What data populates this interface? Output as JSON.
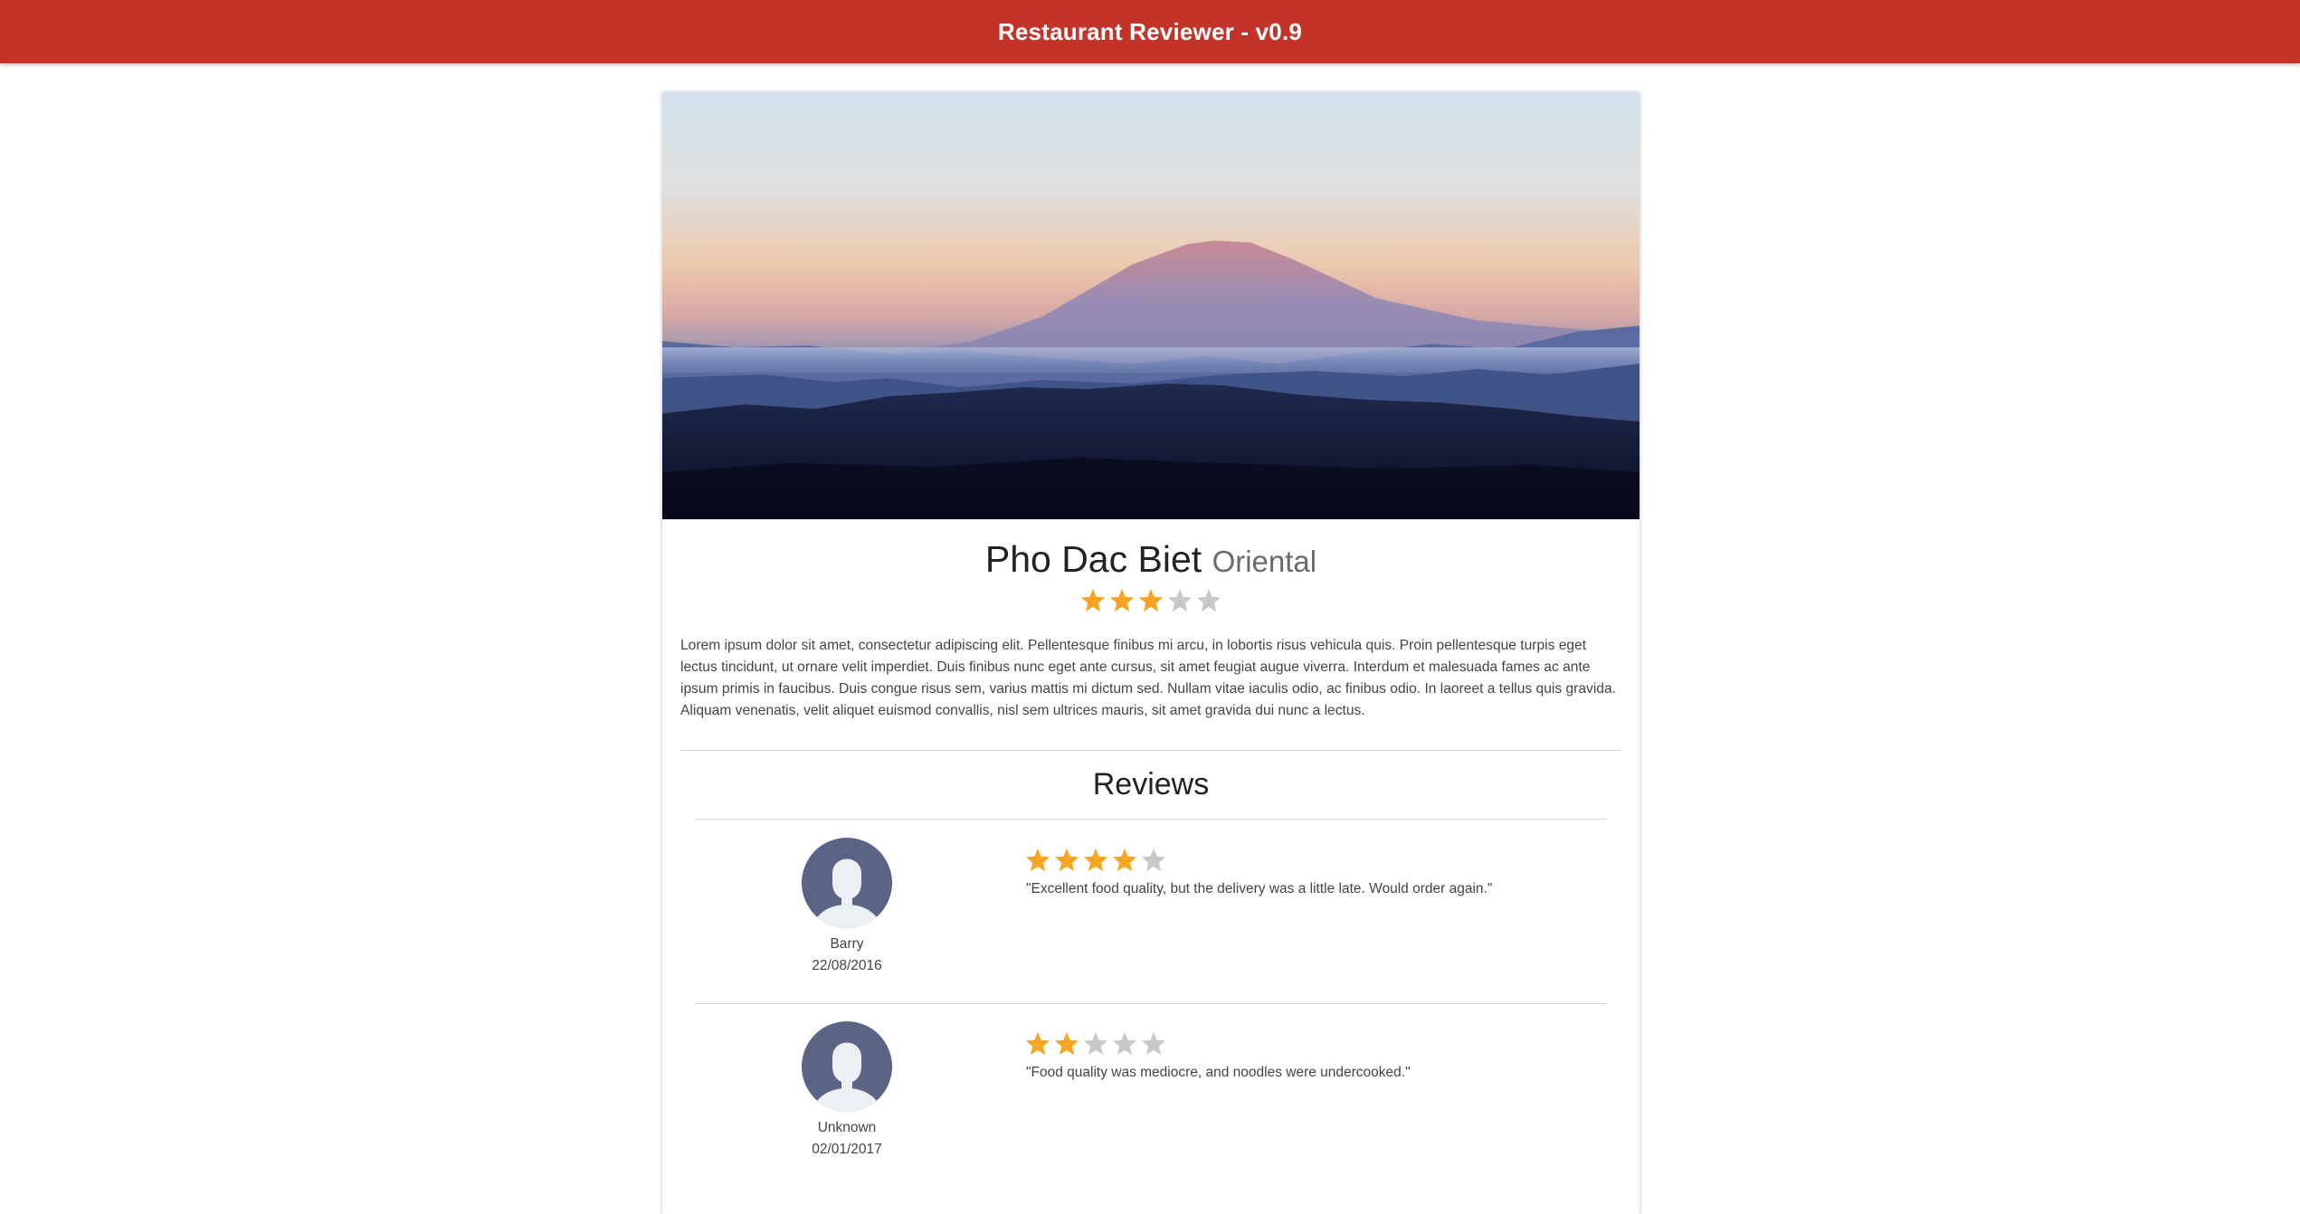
{
  "header": {
    "title": "Restaurant Reviewer - v0.9"
  },
  "colors": {
    "brand": "#c2342a",
    "star_filled": "#f5a623",
    "star_empty": "#c8c8c8",
    "avatar_bg": "#5a6585"
  },
  "restaurant": {
    "name": "Pho Dac Biet",
    "category": "Oriental",
    "rating": 3,
    "max_rating": 5,
    "description": "Lorem ipsum dolor sit amet, consectetur adipiscing elit. Pellentesque finibus mi arcu, in lobortis risus vehicula quis. Proin pellentesque turpis eget lectus tincidunt, ut ornare velit imperdiet. Duis finibus nunc eget ante cursus, sit amet feugiat augue viverra. Interdum et malesuada fames ac ante ipsum primis in faucibus. Duis congue risus sem, varius mattis mi dictum sed. Nullam vitae iaculis odio, ac finibus odio. In laoreet a tellus quis gravida. Aliquam venenatis, velit aliquet euismod convallis, nisl sem ultrices mauris, sit amet gravida dui nunc a lectus."
  },
  "reviews_section": {
    "title": "Reviews",
    "items": [
      {
        "author": "Barry",
        "date": "22/08/2016",
        "rating": 4,
        "text": "\"Excellent food quality, but the delivery was a little late. Would order again.\""
      },
      {
        "author": "Unknown",
        "date": "02/01/2017",
        "rating": 2,
        "text": "\"Food quality was mediocre, and noodles were undercooked.\""
      }
    ]
  }
}
